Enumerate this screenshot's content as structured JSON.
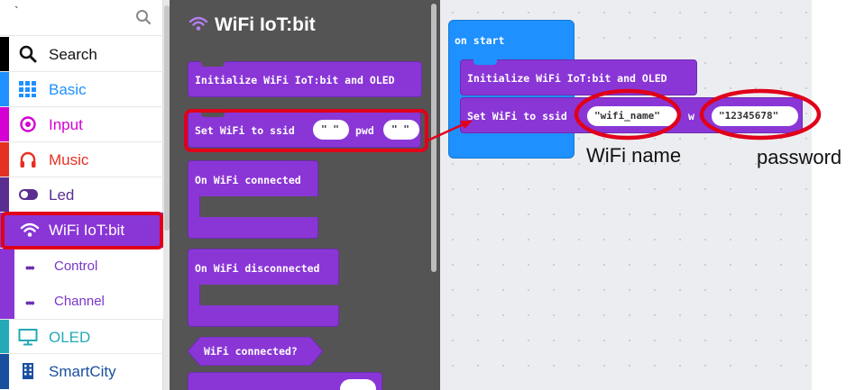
{
  "sidebar": {
    "search_tick": "`",
    "categories": [
      {
        "label": "Search",
        "color": "#000000",
        "icon": "magnifier-icon"
      },
      {
        "label": "Basic",
        "color": "#1e90ff",
        "icon": "grid-icon"
      },
      {
        "label": "Input",
        "color": "#d400d4",
        "icon": "target-icon"
      },
      {
        "label": "Music",
        "color": "#e63022",
        "icon": "headphones-icon"
      },
      {
        "label": "Led",
        "color": "#5c2d91",
        "icon": "toggle-icon"
      },
      {
        "label": "WiFi IoT:bit",
        "color": "#8a36d6",
        "icon": "wifi-icon"
      },
      {
        "label": "OLED",
        "color": "#24a9b6",
        "icon": "monitor-icon"
      },
      {
        "label": "SmartCity",
        "color": "#1a4fa0",
        "icon": "building-icon"
      }
    ],
    "subcategories": [
      {
        "label": "Control"
      },
      {
        "label": "Channel"
      }
    ]
  },
  "flyout": {
    "title": "WiFi IoT:bit",
    "blocks": {
      "init": "Initialize WiFi IoT:bit and OLED",
      "set_wifi_prefix": "Set WiFi to ssid",
      "set_wifi_pwd": "pwd",
      "empty_string": "\" \"",
      "on_connected": "On WiFi connected",
      "on_disconnected": "On WiFi disconnected",
      "connected_q": "WiFi connected?"
    }
  },
  "workspace": {
    "on_start": "on start",
    "init": "Initialize WiFi IoT:bit and OLED",
    "set_wifi_prefix": "Set WiFi to ssid",
    "pwd_fragment": "w",
    "ssid_value": "\"wifi_name\"",
    "pwd_value": "\"12345678\""
  },
  "annotations": {
    "wifi_name": "WiFi name",
    "password": "password"
  },
  "colors": {
    "block_purple": "#8a36d6",
    "on_start_blue": "#1e90ff",
    "highlight_red": "#e0001a",
    "flyout_bg": "#545454"
  }
}
